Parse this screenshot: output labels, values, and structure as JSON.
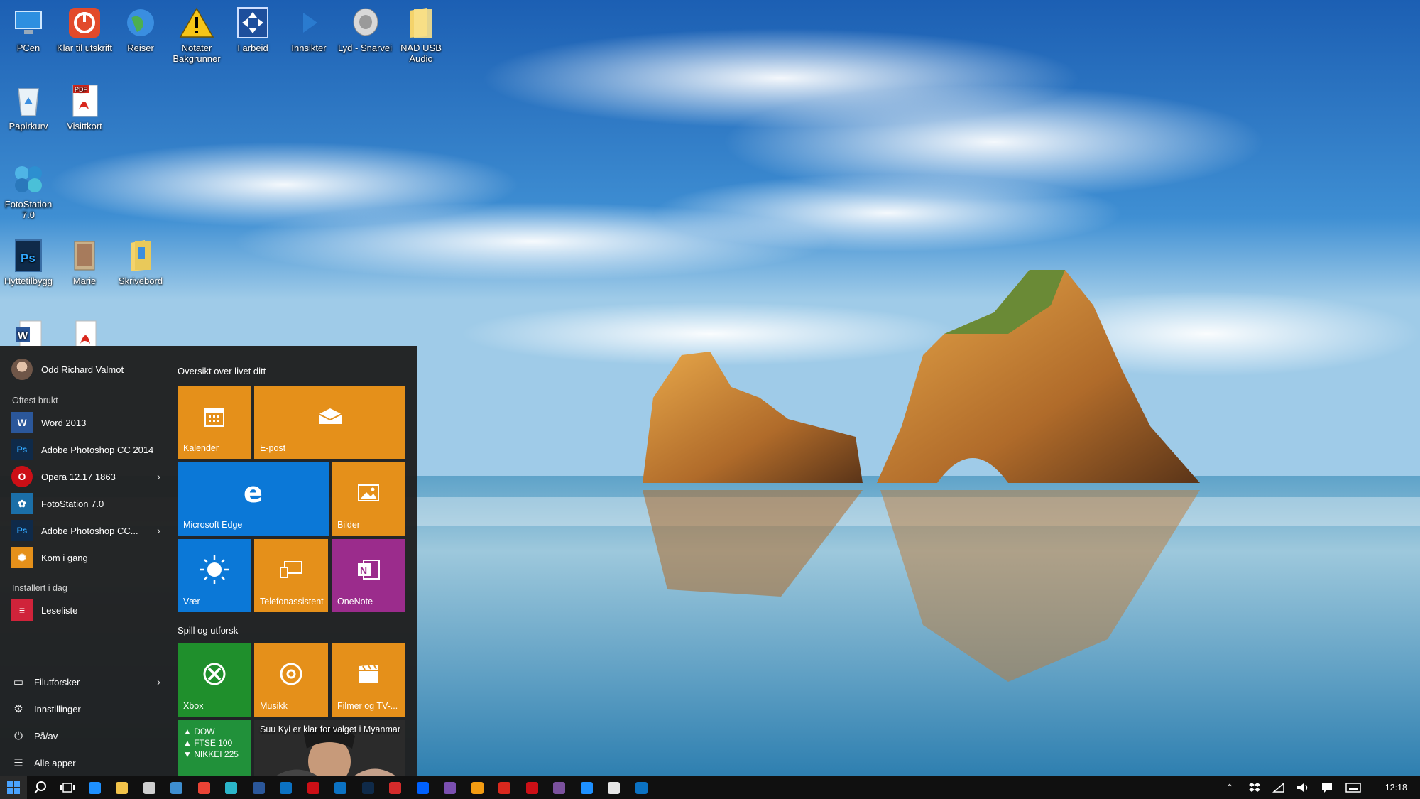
{
  "desktop": {
    "icons": [
      {
        "label": "PCen",
        "icon": "computer-icon"
      },
      {
        "label": "Klar til utskrift",
        "icon": "power-icon"
      },
      {
        "label": "Reiser",
        "icon": "globe-icon"
      },
      {
        "label": "Notater Bakgrunner",
        "icon": "warning-icon"
      },
      {
        "label": "I arbeid",
        "icon": "move-icon"
      },
      {
        "label": "Innsikter",
        "icon": "arrow-icon"
      },
      {
        "label": "Lyd - Snarvei",
        "icon": "speaker-icon"
      },
      {
        "label": "NAD USB Audio",
        "icon": "folder-icon"
      },
      {
        "label": "Papirkurv",
        "icon": "recycle-bin-icon"
      },
      {
        "label": "Visittkort",
        "icon": "pdf-icon"
      },
      {
        "label": "FotoStation 7.0",
        "icon": "fotostation-icon"
      },
      {
        "label": "Hyttetilbygg",
        "icon": "photoshop-file-icon"
      },
      {
        "label": "Marie",
        "icon": "folder-icon"
      },
      {
        "label": "Skrivebord",
        "icon": "folder-icon"
      },
      {
        "label": "",
        "icon": "word-document-icon"
      },
      {
        "label": "",
        "icon": "pdf-icon"
      }
    ]
  },
  "start_menu": {
    "user_name": "Odd Richard Valmot",
    "most_used_title": "Oftest brukt",
    "most_used": [
      {
        "label": "Word 2013",
        "icon": "word-icon",
        "color": "#2b579a",
        "glyph": "W"
      },
      {
        "label": "Adobe Photoshop CC 2014",
        "icon": "photoshop-icon",
        "color": "#0f2a49",
        "glyph": "Ps"
      },
      {
        "label": "Opera 12.17 1863",
        "icon": "opera-icon",
        "color": "#cc0f16",
        "glyph": "O"
      },
      {
        "label": "FotoStation 7.0",
        "icon": "fotostation-icon",
        "color": "#1b6fa8",
        "glyph": "✿"
      },
      {
        "label": "Adobe Photoshop CC...",
        "icon": "photoshop-icon",
        "color": "#0f2a49",
        "glyph": "Ps"
      },
      {
        "label": "Kom i gang",
        "icon": "lightbulb-icon",
        "color": "#e5901a",
        "glyph": "💡"
      }
    ],
    "installed_today_title": "Installert i dag",
    "installed_today": [
      {
        "label": "Leseliste",
        "icon": "reading-list-icon",
        "color": "#d0233a",
        "glyph": "≡"
      }
    ],
    "system": [
      {
        "label": "Filutforsker",
        "icon": "file-explorer-icon",
        "glyph": "🗀"
      },
      {
        "label": "Innstillinger",
        "icon": "settings-icon",
        "glyph": "⚙"
      },
      {
        "label": "På/av",
        "icon": "power-icon",
        "glyph": "⏻"
      },
      {
        "label": "Alle apper",
        "icon": "all-apps-icon",
        "glyph": "☰"
      }
    ],
    "group1_title": "Oversikt over livet ditt",
    "group2_title": "Spill og utforsk",
    "tiles": {
      "calendar": "Kalender",
      "mail": "E-post",
      "edge": "Microsoft Edge",
      "photos": "Bilder",
      "weather": "Vær",
      "phone": "Telefonassistent",
      "onenote": "OneNote",
      "xbox": "Xbox",
      "music": "Musikk",
      "movies": "Filmer og TV-...",
      "money": [
        "▲ DOW",
        "▲ FTSE 100",
        "▼ NIKKEI 225"
      ],
      "news": "Suu Kyi er klar for valget i Myanmar"
    }
  },
  "taskbar": {
    "clock": "12:18",
    "pinned_colors": [
      "#1e90ff",
      "#f2c34a",
      "#cfcfcf",
      "#3e8ed0",
      "#ea4335",
      "#2bb5c9",
      "#2b579a",
      "#0b72c3",
      "#cc0f16",
      "#0b72c3",
      "#0f2a49",
      "#d42b2b",
      "#0061fe",
      "#7b4fb0",
      "#f39c12",
      "#d9281d",
      "#cc0f16",
      "#7b519d",
      "#1e90ff",
      "#e6e6e6",
      "#0b72c3"
    ]
  }
}
